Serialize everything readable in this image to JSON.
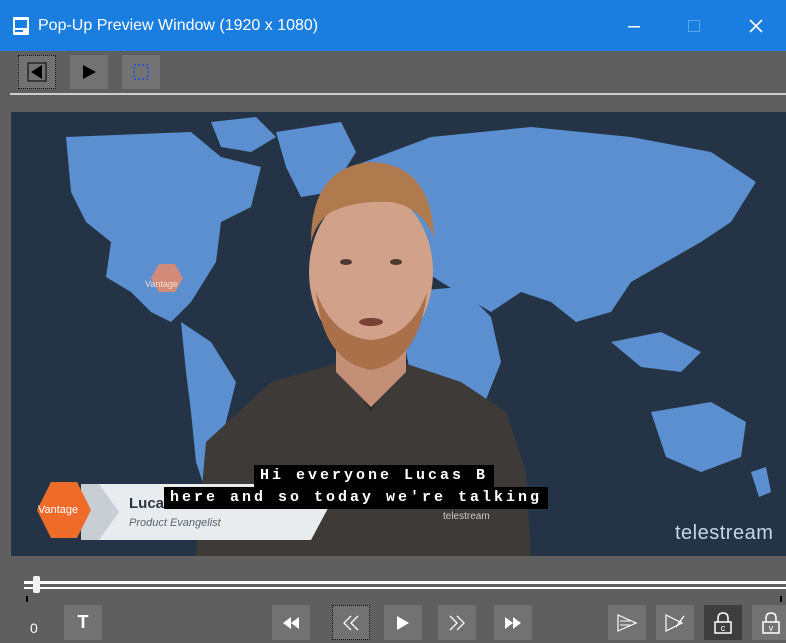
{
  "window": {
    "title": "Pop-Up Preview Window (1920 x 1080)",
    "icons": {
      "app": "preview-icon",
      "minimize": "minimize-icon",
      "maximize": "maximize-icon",
      "close": "close-icon"
    }
  },
  "toolbar": {
    "buttons": [
      {
        "name": "previous-button",
        "icon": "arrow-left-icon"
      },
      {
        "name": "next-button",
        "icon": "arrow-right-icon"
      },
      {
        "name": "select-region-button",
        "icon": "dotted-square-icon"
      }
    ]
  },
  "video": {
    "caption_lines": [
      "Hi everyone Lucas B",
      "here and so today we're talking"
    ],
    "lower_third": {
      "name": "Luca",
      "role": "Product Evangelist",
      "badge": "Vantage"
    },
    "map_badge": "Vantage",
    "brand": "telestream",
    "shirt_logo": "telestream"
  },
  "timeline": {
    "frame": "0",
    "position": 0.013
  },
  "controls": {
    "text_button": "T",
    "buttons": [
      "rewind-icon",
      "step-back-icon",
      "play-icon",
      "step-forward-icon",
      "fast-forward-icon",
      "caption-send-icon",
      "caption-edit-icon",
      "lock-c-icon",
      "lock-v-icon"
    ],
    "lock_c": "c",
    "lock_v": "v"
  },
  "colors": {
    "titlebar": "#1a7ee0",
    "panel": "#5f5f5f",
    "button": "#727272",
    "map_bg": "#243345",
    "land": "#5b8fd0",
    "accent_orange": "#ef6b2a"
  }
}
